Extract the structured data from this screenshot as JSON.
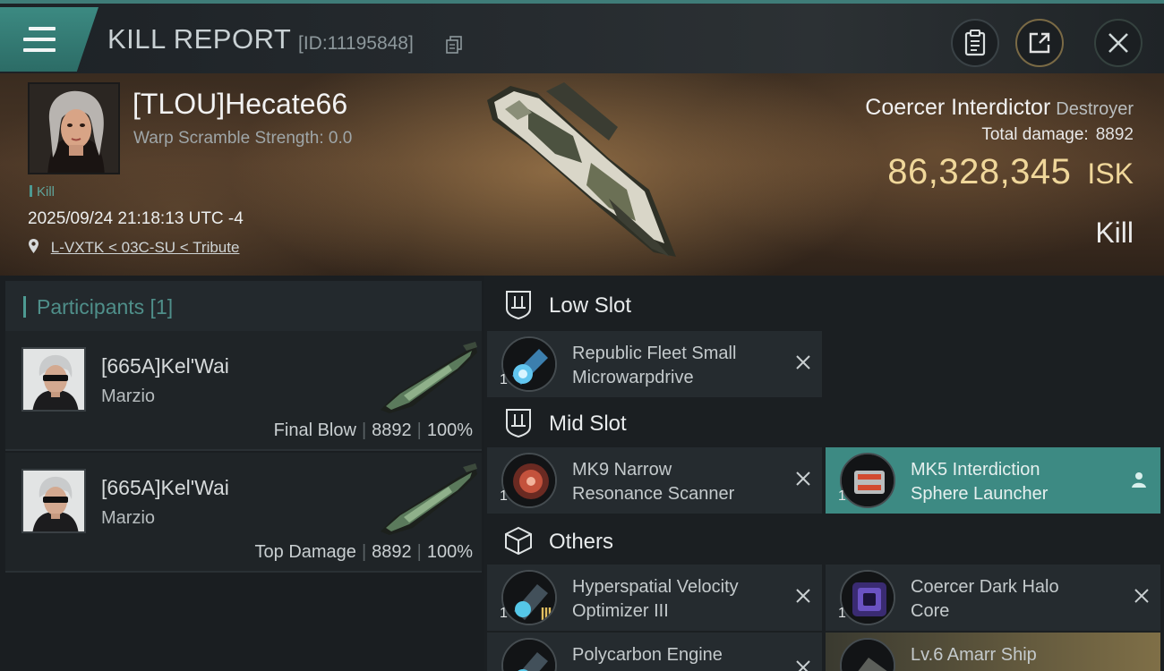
{
  "header": {
    "title": "KILL REPORT",
    "id_text": "[ID:11195848]"
  },
  "victim": {
    "name": "[TLOU]Hecate66",
    "warp_scramble": "Warp Scramble Strength: 0.0",
    "tag": "Kill",
    "datetime": "2025/09/24 21:18:13 UTC -4",
    "location": "L-VXTK < 03C-SU < Tribute",
    "ship_name": "Coercer Interdictor",
    "ship_class": "Destroyer",
    "total_damage_label": "Total damage:",
    "total_damage": "8892",
    "isk_value": "86,328,345",
    "isk_unit": "ISK",
    "result": "Kill"
  },
  "participants": {
    "title": "Participants [1]",
    "items": [
      {
        "name": "[665A]Kel'Wai",
        "ship": "Marzio",
        "role": "Final Blow",
        "damage": "8892",
        "percent": "100%"
      },
      {
        "name": "[665A]Kel'Wai",
        "ship": "Marzio",
        "role": "Top Damage",
        "damage": "8892",
        "percent": "100%"
      }
    ]
  },
  "slots": {
    "low": {
      "label": "Low Slot",
      "items": [
        {
          "qty": "1",
          "line1": "Republic Fleet Small",
          "line2": "Microwarpdrive"
        }
      ]
    },
    "mid": {
      "label": "Mid Slot",
      "items": [
        {
          "qty": "1",
          "line1": "MK9 Narrow",
          "line2": "Resonance Scanner"
        },
        {
          "qty": "1",
          "line1": "MK5 Interdiction",
          "line2": "Sphere Launcher"
        }
      ]
    },
    "others": {
      "label": "Others",
      "items": [
        {
          "qty": "1",
          "line1": "Hyperspatial Velocity",
          "line2": "Optimizer III"
        },
        {
          "qty": "1",
          "line1": "Coercer Dark Halo",
          "line2": "Core"
        },
        {
          "qty": "",
          "line1": "Polycarbon Engine",
          "line2": ""
        },
        {
          "qty": "",
          "line1": "Lv.6 Amarr Ship",
          "line2": ""
        }
      ]
    }
  },
  "colors": {
    "accent_teal": "#3d8a83",
    "isk_gold": "#f0d79a"
  },
  "icons": [
    "menu-icon",
    "copy-icon",
    "clipboard-icon",
    "share-icon",
    "close-icon",
    "location-pin-icon",
    "low-slot-icon",
    "mid-slot-icon",
    "others-cube-icon",
    "remove-x-icon",
    "user-icon"
  ]
}
